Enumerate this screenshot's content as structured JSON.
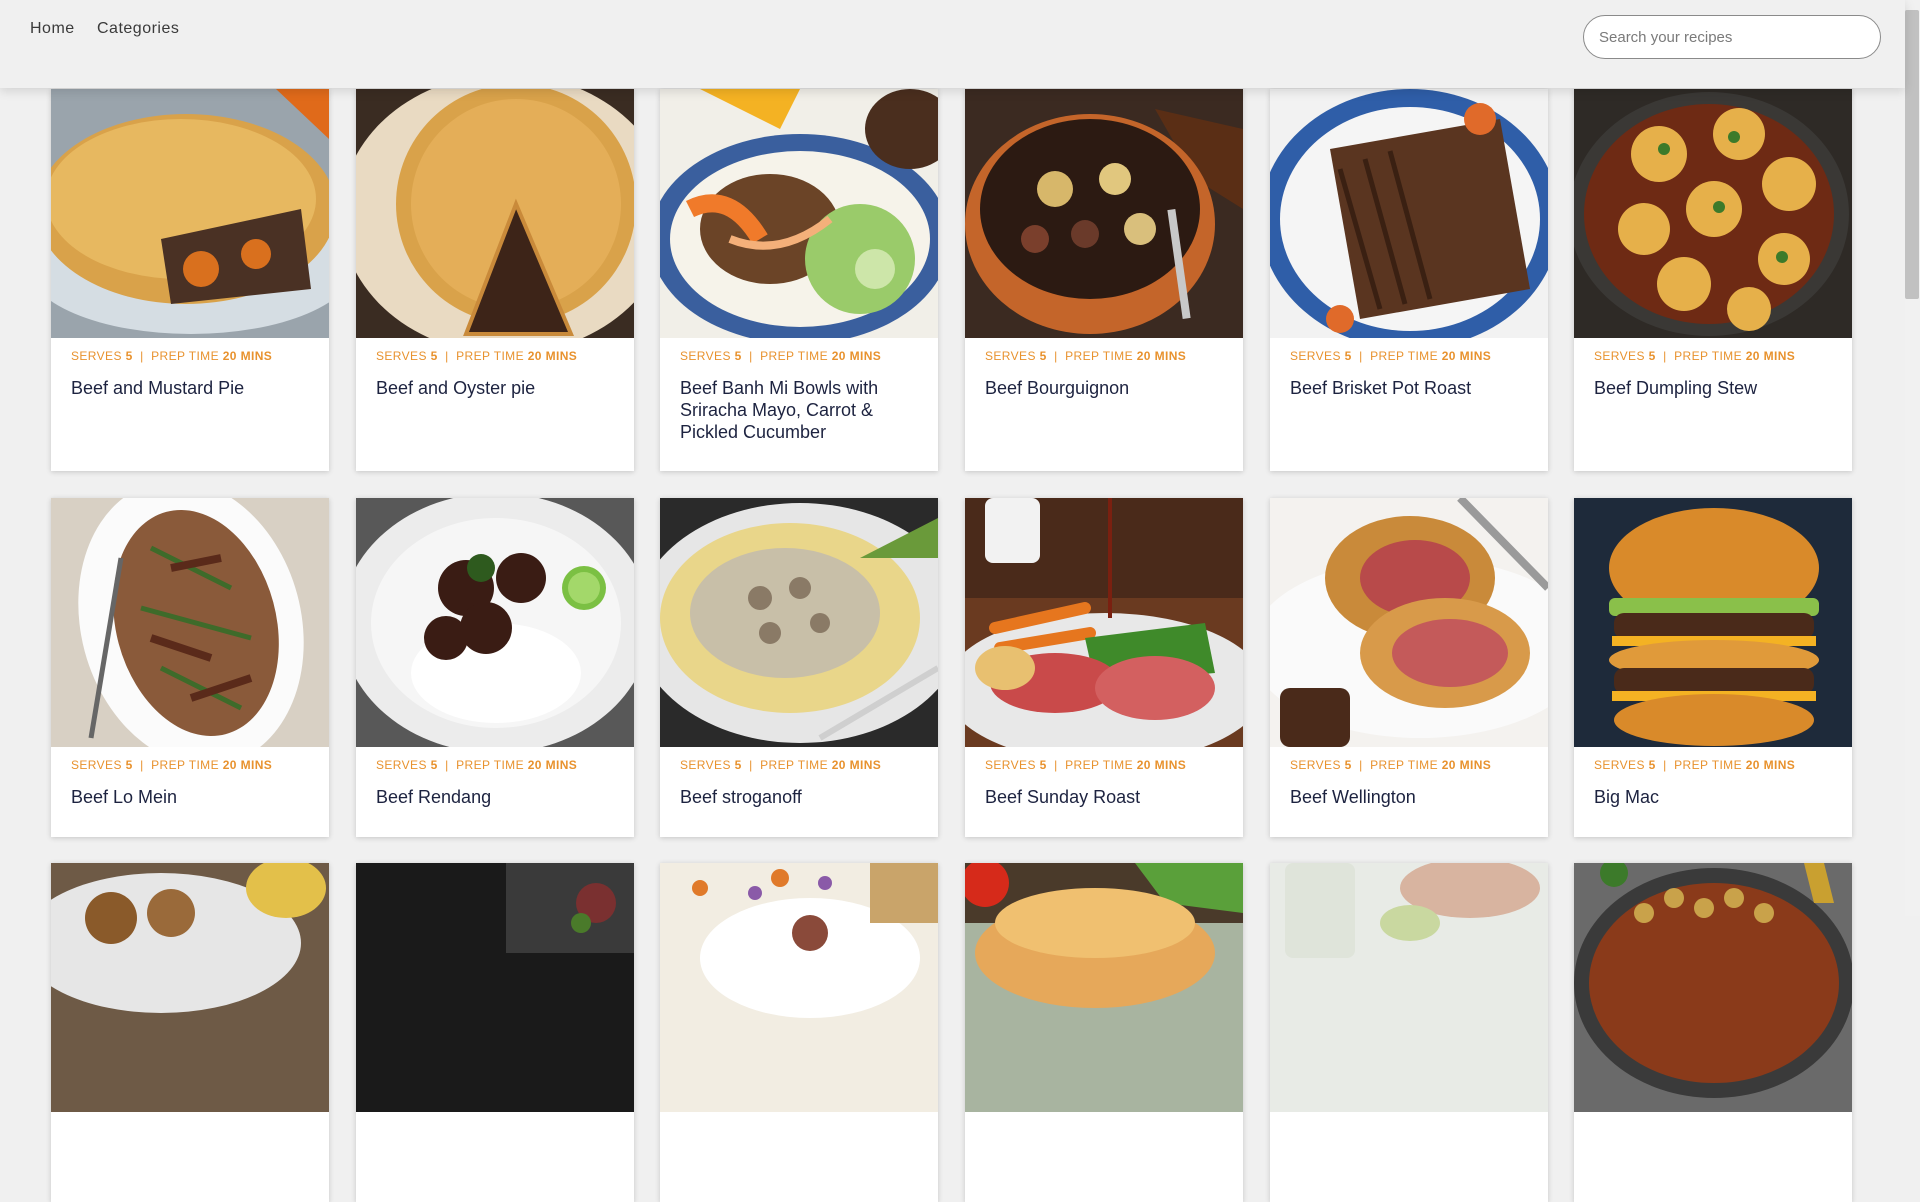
{
  "nav": {
    "home": "Home",
    "categories": "Categories"
  },
  "search": {
    "placeholder": "Search your recipes",
    "value": ""
  },
  "recipe_meta": {
    "serves_label": "SERVES",
    "serves_value": "5",
    "separator": "|",
    "prep_label": "PREP TIME",
    "prep_value": "20 MINS"
  },
  "recipes": [
    {
      "title": "Beef and Mustard Pie",
      "image": "pie"
    },
    {
      "title": "Beef and Oyster pie",
      "image": "pie-slice"
    },
    {
      "title": "Beef Banh Mi Bowls with Sriracha Mayo, Carrot & Pickled Cucumber",
      "image": "rice-bowl"
    },
    {
      "title": "Beef Bourguignon",
      "image": "stew-pot"
    },
    {
      "title": "Beef Brisket Pot Roast",
      "image": "sliced-roast"
    },
    {
      "title": "Beef Dumpling Stew",
      "image": "dumpling-pan"
    },
    {
      "title": "Beef Lo Mein",
      "image": "noodle-platter"
    },
    {
      "title": "Beef Rendang",
      "image": "rendang-plate"
    },
    {
      "title": "Beef stroganoff",
      "image": "stroganoff-plate"
    },
    {
      "title": "Beef Sunday Roast",
      "image": "roast-dinner"
    },
    {
      "title": "Beef Wellington",
      "image": "wellington"
    },
    {
      "title": "Big Mac",
      "image": "burger"
    },
    {
      "title": "",
      "image": "fritters"
    },
    {
      "title": "",
      "image": "dark-dish"
    },
    {
      "title": "",
      "image": "tablecloth"
    },
    {
      "title": "",
      "image": "sandwich"
    },
    {
      "title": "",
      "image": "jars"
    },
    {
      "title": "",
      "image": "beans-pot"
    }
  ]
}
